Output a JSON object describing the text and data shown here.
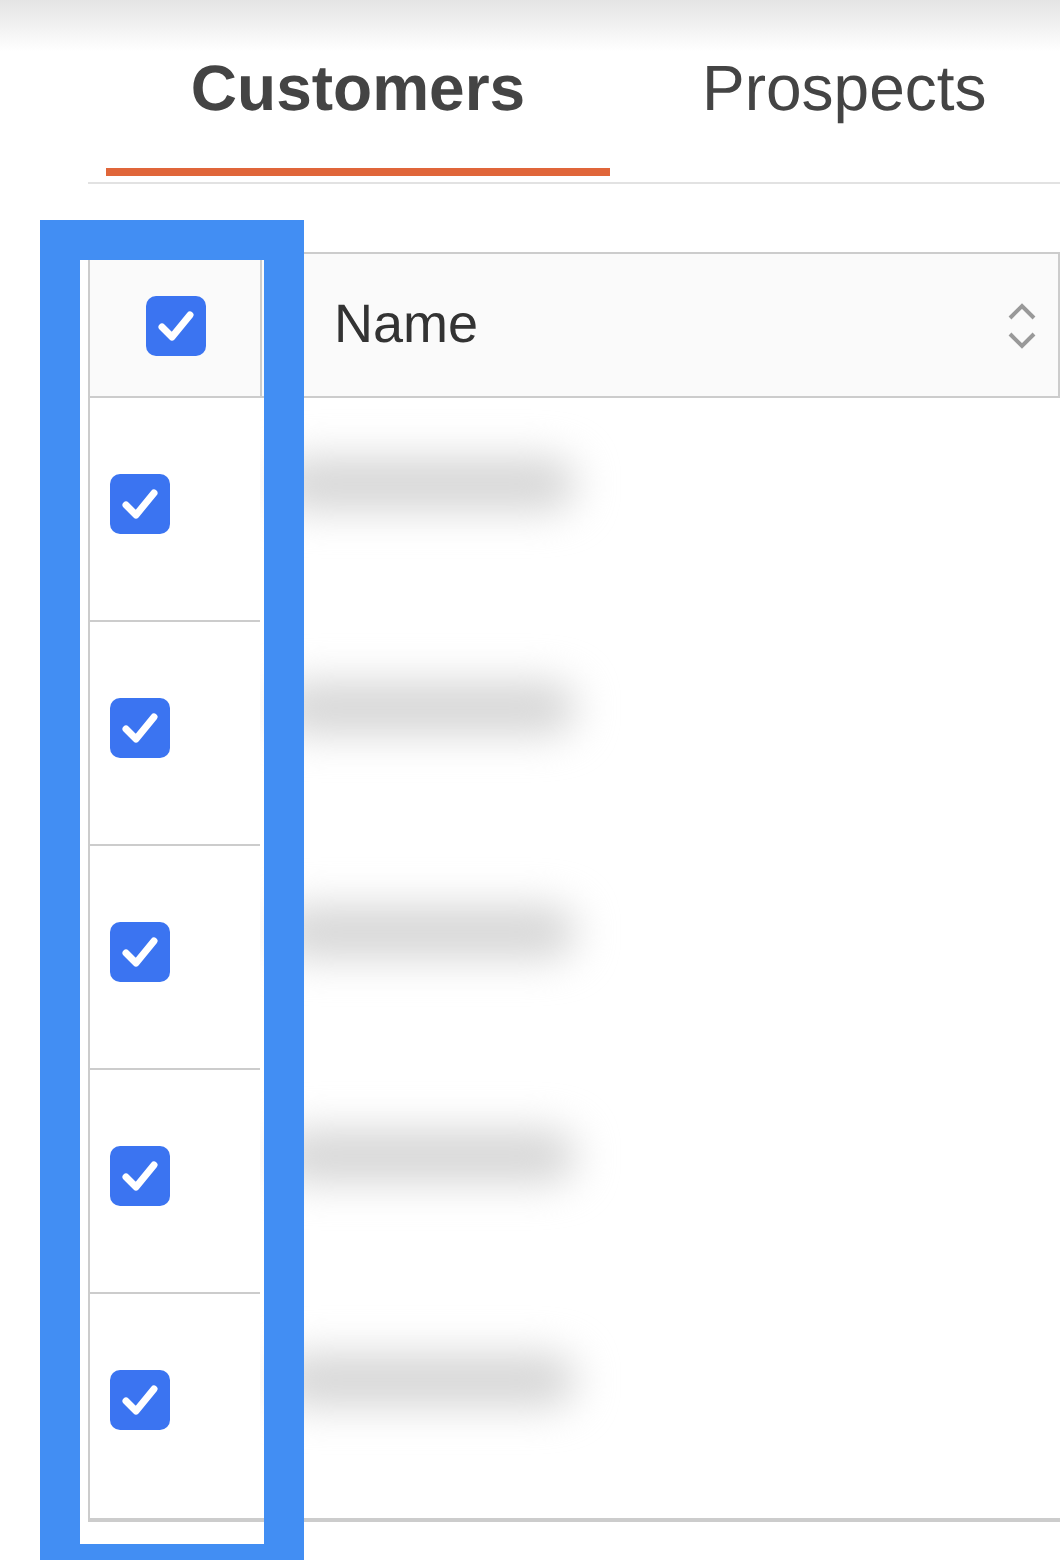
{
  "tabs": [
    {
      "label": "Customers",
      "selected": true
    },
    {
      "label": "Prospects",
      "selected": false
    }
  ],
  "table": {
    "select_all": {
      "checked": true
    },
    "columns": [
      {
        "label": "Name",
        "sortable": true
      }
    ],
    "rows": [
      {
        "checked": true
      },
      {
        "checked": true
      },
      {
        "checked": true
      },
      {
        "checked": true
      },
      {
        "checked": true
      }
    ]
  },
  "annotation": {
    "kind": "highlight-box"
  }
}
